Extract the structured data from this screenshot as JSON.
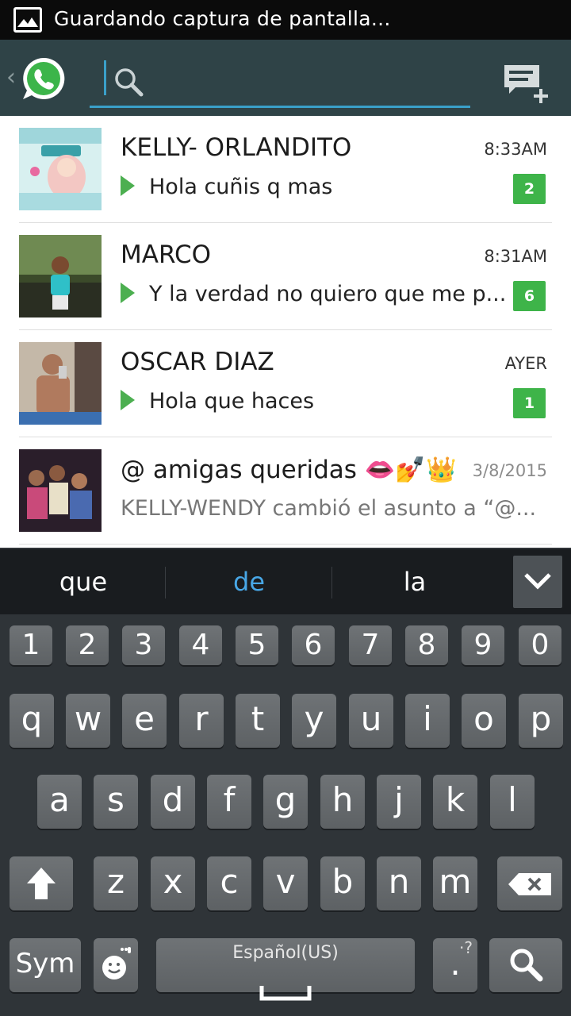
{
  "status_bar": {
    "notification_text": "Guardando captura de pantalla..."
  },
  "action_bar": {
    "search_placeholder": ""
  },
  "chats": [
    {
      "name": "KELLY- ORLANDITO",
      "time": "8:33AM",
      "message": "Hola cuñis q mas",
      "unread": "2"
    },
    {
      "name": "MARCO",
      "time": "8:31AM",
      "message": "Y la verdad no quiero que me p...",
      "unread": "6"
    },
    {
      "name": "OSCAR DIAZ",
      "time": "AYER",
      "message": "Hola que haces",
      "unread": "1"
    },
    {
      "name": "@ amigas queridas 👄💅👑",
      "time": "3/8/2015",
      "message": "KELLY-WENDY cambió el asunto a “@...",
      "unread": ""
    }
  ],
  "suggestions": [
    "que",
    "de",
    "la"
  ],
  "keyboard": {
    "numbers": [
      "1",
      "2",
      "3",
      "4",
      "5",
      "6",
      "7",
      "8",
      "9",
      "0"
    ],
    "row1": [
      "q",
      "w",
      "e",
      "r",
      "t",
      "y",
      "u",
      "i",
      "o",
      "p"
    ],
    "row2": [
      "a",
      "s",
      "d",
      "f",
      "g",
      "h",
      "j",
      "k",
      "l"
    ],
    "row3": [
      "z",
      "x",
      "c",
      "v",
      "b",
      "n",
      "m"
    ],
    "sym_label": "Sym",
    "space_label": "Español(US)",
    "period_label": ".",
    "period_hint": "·?"
  },
  "colors": {
    "accent": "#3aa0c9",
    "badge": "#3eb449",
    "actionbar": "#2f4347"
  }
}
